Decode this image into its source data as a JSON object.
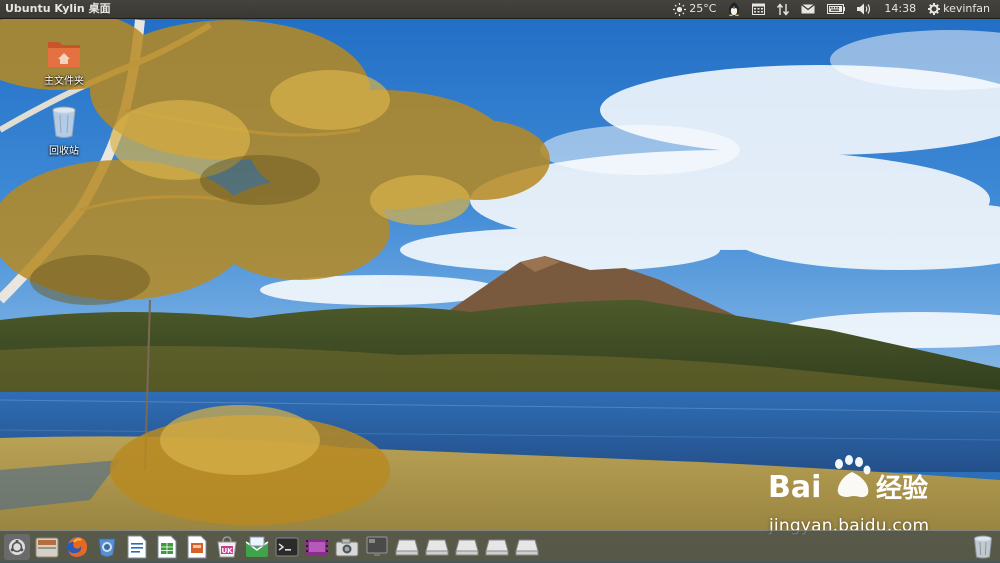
{
  "top_panel": {
    "title": "Ubuntu Kylin 桌面",
    "weather": {
      "icon": "sun-icon",
      "temp": "25°C"
    },
    "clock": "14:38",
    "user": "kevinfan",
    "indicators": [
      "sun-icon",
      "penguin-icon",
      "calendar-icon",
      "network-updown-icon",
      "mail-icon",
      "keyboard-icon",
      "volume-icon",
      "gear-icon"
    ]
  },
  "desktop": {
    "icons": [
      {
        "label": "主文件夹",
        "icon": "home-folder-icon"
      },
      {
        "label": "回收站",
        "icon": "trash-icon"
      }
    ]
  },
  "dock": {
    "items": [
      {
        "name": "dash-home-icon"
      },
      {
        "name": "file-manager-icon"
      },
      {
        "name": "firefox-icon"
      },
      {
        "name": "chromium-icon"
      },
      {
        "name": "writer-icon"
      },
      {
        "name": "calc-icon"
      },
      {
        "name": "impress-icon"
      },
      {
        "name": "software-center-icon"
      },
      {
        "name": "mail-client-icon"
      },
      {
        "name": "terminal-icon"
      },
      {
        "name": "video-player-icon"
      },
      {
        "name": "camera-icon"
      },
      {
        "name": "system-monitor-icon"
      },
      {
        "name": "drive-icon"
      },
      {
        "name": "drive-icon"
      },
      {
        "name": "drive-icon"
      },
      {
        "name": "drive-icon"
      },
      {
        "name": "drive-icon"
      },
      {
        "name": "trash-icon"
      }
    ]
  },
  "watermark": {
    "brand": "Bai 经验",
    "url": "jingyan.baidu.com"
  }
}
